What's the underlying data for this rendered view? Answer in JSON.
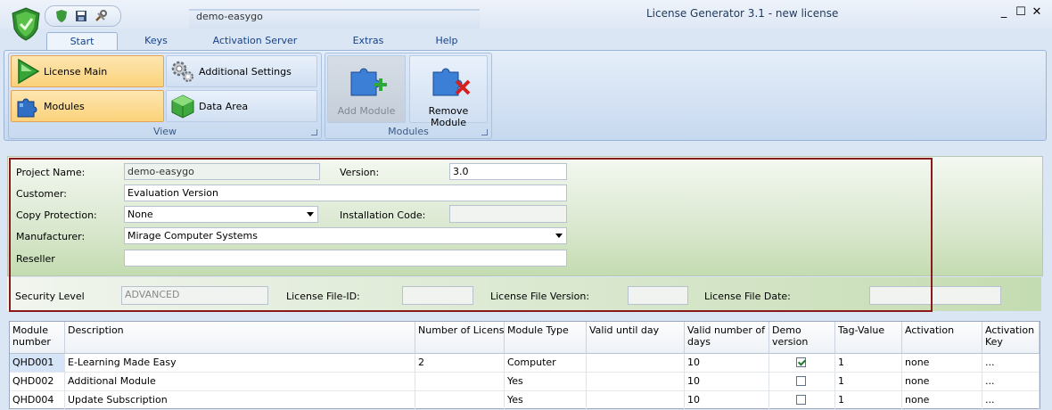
{
  "window": {
    "title": "License Generator 3.1 - new license",
    "context_tab": "demo-easygo",
    "controls": [
      "_",
      "☐",
      "✕"
    ]
  },
  "tabs": [
    "Start",
    "Keys",
    "Activation Server",
    "Extras",
    "Help"
  ],
  "ribbon": {
    "view_group": {
      "label": "View",
      "buttons": [
        "License Main",
        "Additional Settings",
        "Modules",
        "Data Area"
      ]
    },
    "modules_group": {
      "label": "Modules",
      "add_module": "Add Module",
      "remove_module": "Remove Module"
    }
  },
  "form": {
    "project_name_label": "Project Name:",
    "project_name": "demo-easygo",
    "version_label": "Version:",
    "version": "3.0",
    "customer_label": "Customer:",
    "customer": "Evaluation Version",
    "copy_protection_label": "Copy Protection:",
    "copy_protection": "None",
    "installation_code_label": "Installation Code:",
    "installation_code": "",
    "manufacturer_label": "Manufacturer:",
    "manufacturer": "Mirage Computer Systems",
    "reseller_label": "Reseller",
    "reseller": ""
  },
  "security": {
    "security_level_label": "Security Level",
    "security_level": "ADVANCED",
    "license_file_id_label": "License File-ID:",
    "license_file_id": "",
    "license_file_version_label": "License File Version:",
    "license_file_version": "",
    "license_file_date_label": "License File Date:",
    "license_file_date": ""
  },
  "grid": {
    "columns": [
      "Module number",
      "Description",
      "Number of Licenses",
      "Module Type",
      "Valid until day",
      "Valid number of days",
      "Demo version",
      "Tag-Value",
      "Activation",
      "Activation Key"
    ],
    "rows": [
      {
        "module_number": "QHD001",
        "description": "E-Learning Made Easy",
        "licenses": "2",
        "module_type": "Computer",
        "valid_until": "",
        "valid_days": "10",
        "demo": true,
        "tag_value": "1",
        "activation": "none",
        "activation_key": "..."
      },
      {
        "module_number": "QHD002",
        "description": "Additional Module",
        "licenses": "",
        "module_type": "Yes",
        "valid_until": "",
        "valid_days": "10",
        "demo": false,
        "tag_value": "1",
        "activation": "none",
        "activation_key": "..."
      },
      {
        "module_number": "QHD004",
        "description": "Update Subscription",
        "licenses": "",
        "module_type": "Yes",
        "valid_until": "",
        "valid_days": "10",
        "demo": false,
        "tag_value": "1",
        "activation": "none",
        "activation_key": "..."
      }
    ]
  }
}
